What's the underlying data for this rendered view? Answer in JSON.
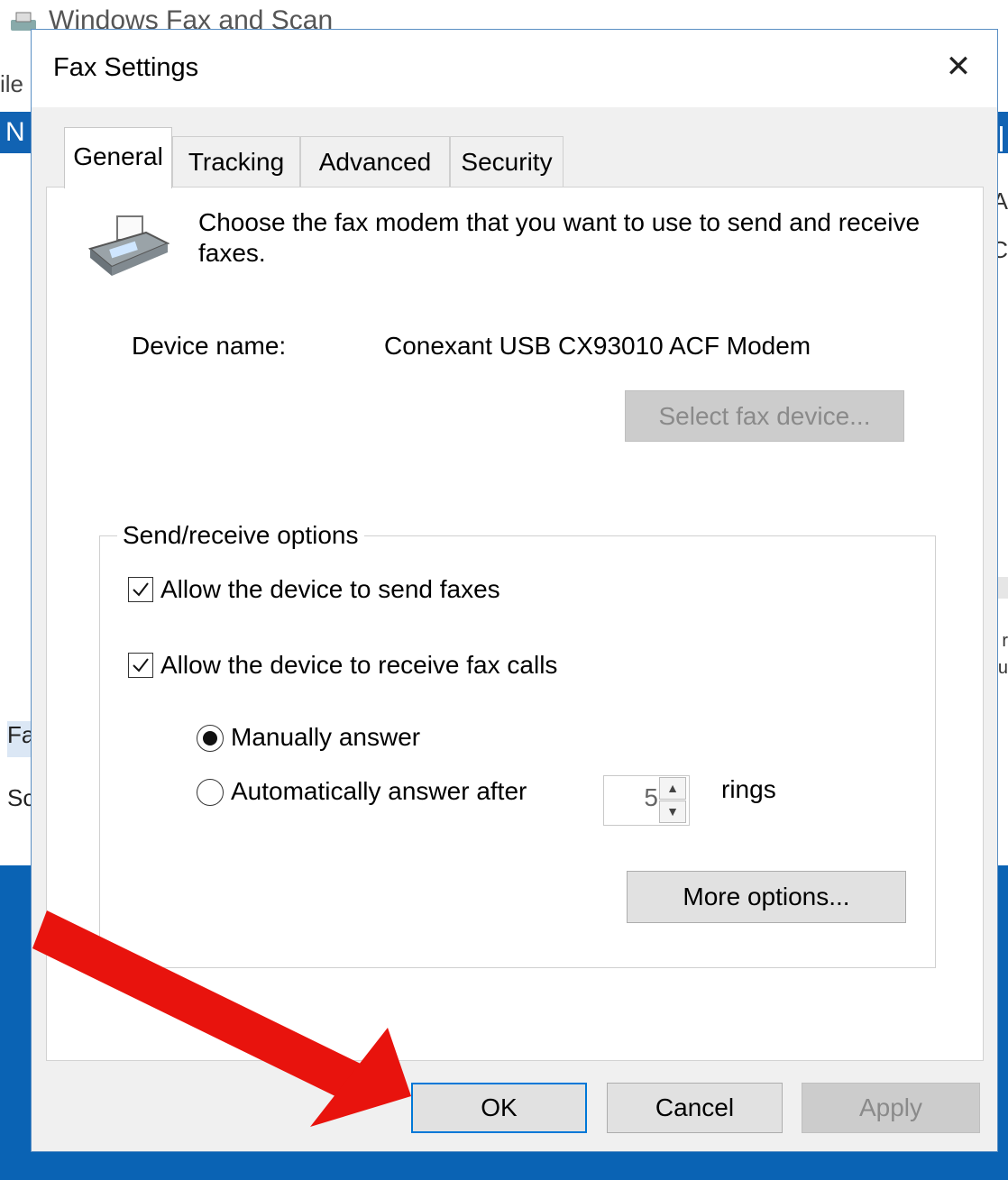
{
  "background_window": {
    "title": "Windows Fax and Scan",
    "menu_fragment": "ile",
    "toolbar_fragment": "N",
    "right_fragments": [
      "A",
      "C",
      "r",
      "r",
      "u"
    ],
    "left_list": [
      "Fa",
      "Sc"
    ]
  },
  "dialog": {
    "title": "Fax Settings",
    "close_glyph": "✕",
    "tabs": [
      "General",
      "Tracking",
      "Advanced",
      "Security"
    ],
    "active_tab": "General",
    "intro_text": "Choose the fax modem that you want to use to send and receive faxes.",
    "device": {
      "label": "Device name:",
      "value": "Conexant USB CX93010 ACF Modem",
      "select_button": "Select fax device..."
    },
    "send_receive": {
      "legend": "Send/receive options",
      "allow_send": {
        "label": "Allow the device to send faxes",
        "checked": true
      },
      "allow_receive": {
        "label": "Allow the device to receive fax calls",
        "checked": true
      },
      "manual_answer": {
        "label": "Manually answer",
        "selected": true
      },
      "auto_answer": {
        "label": "Automatically answer after",
        "selected": false
      },
      "rings_value": "5",
      "rings_label": "rings",
      "more_options_button": "More options..."
    },
    "buttons": {
      "ok": "OK",
      "cancel": "Cancel",
      "apply": "Apply"
    }
  },
  "icons": {
    "fax_machine": "fax-machine-icon",
    "checkbox_check": "checkmark-icon",
    "spin_up": "▲",
    "spin_down": "▼"
  },
  "colors": {
    "accent": "#0078d7",
    "annotation_arrow": "#e8130d",
    "background_blue": "#0a63b4"
  }
}
